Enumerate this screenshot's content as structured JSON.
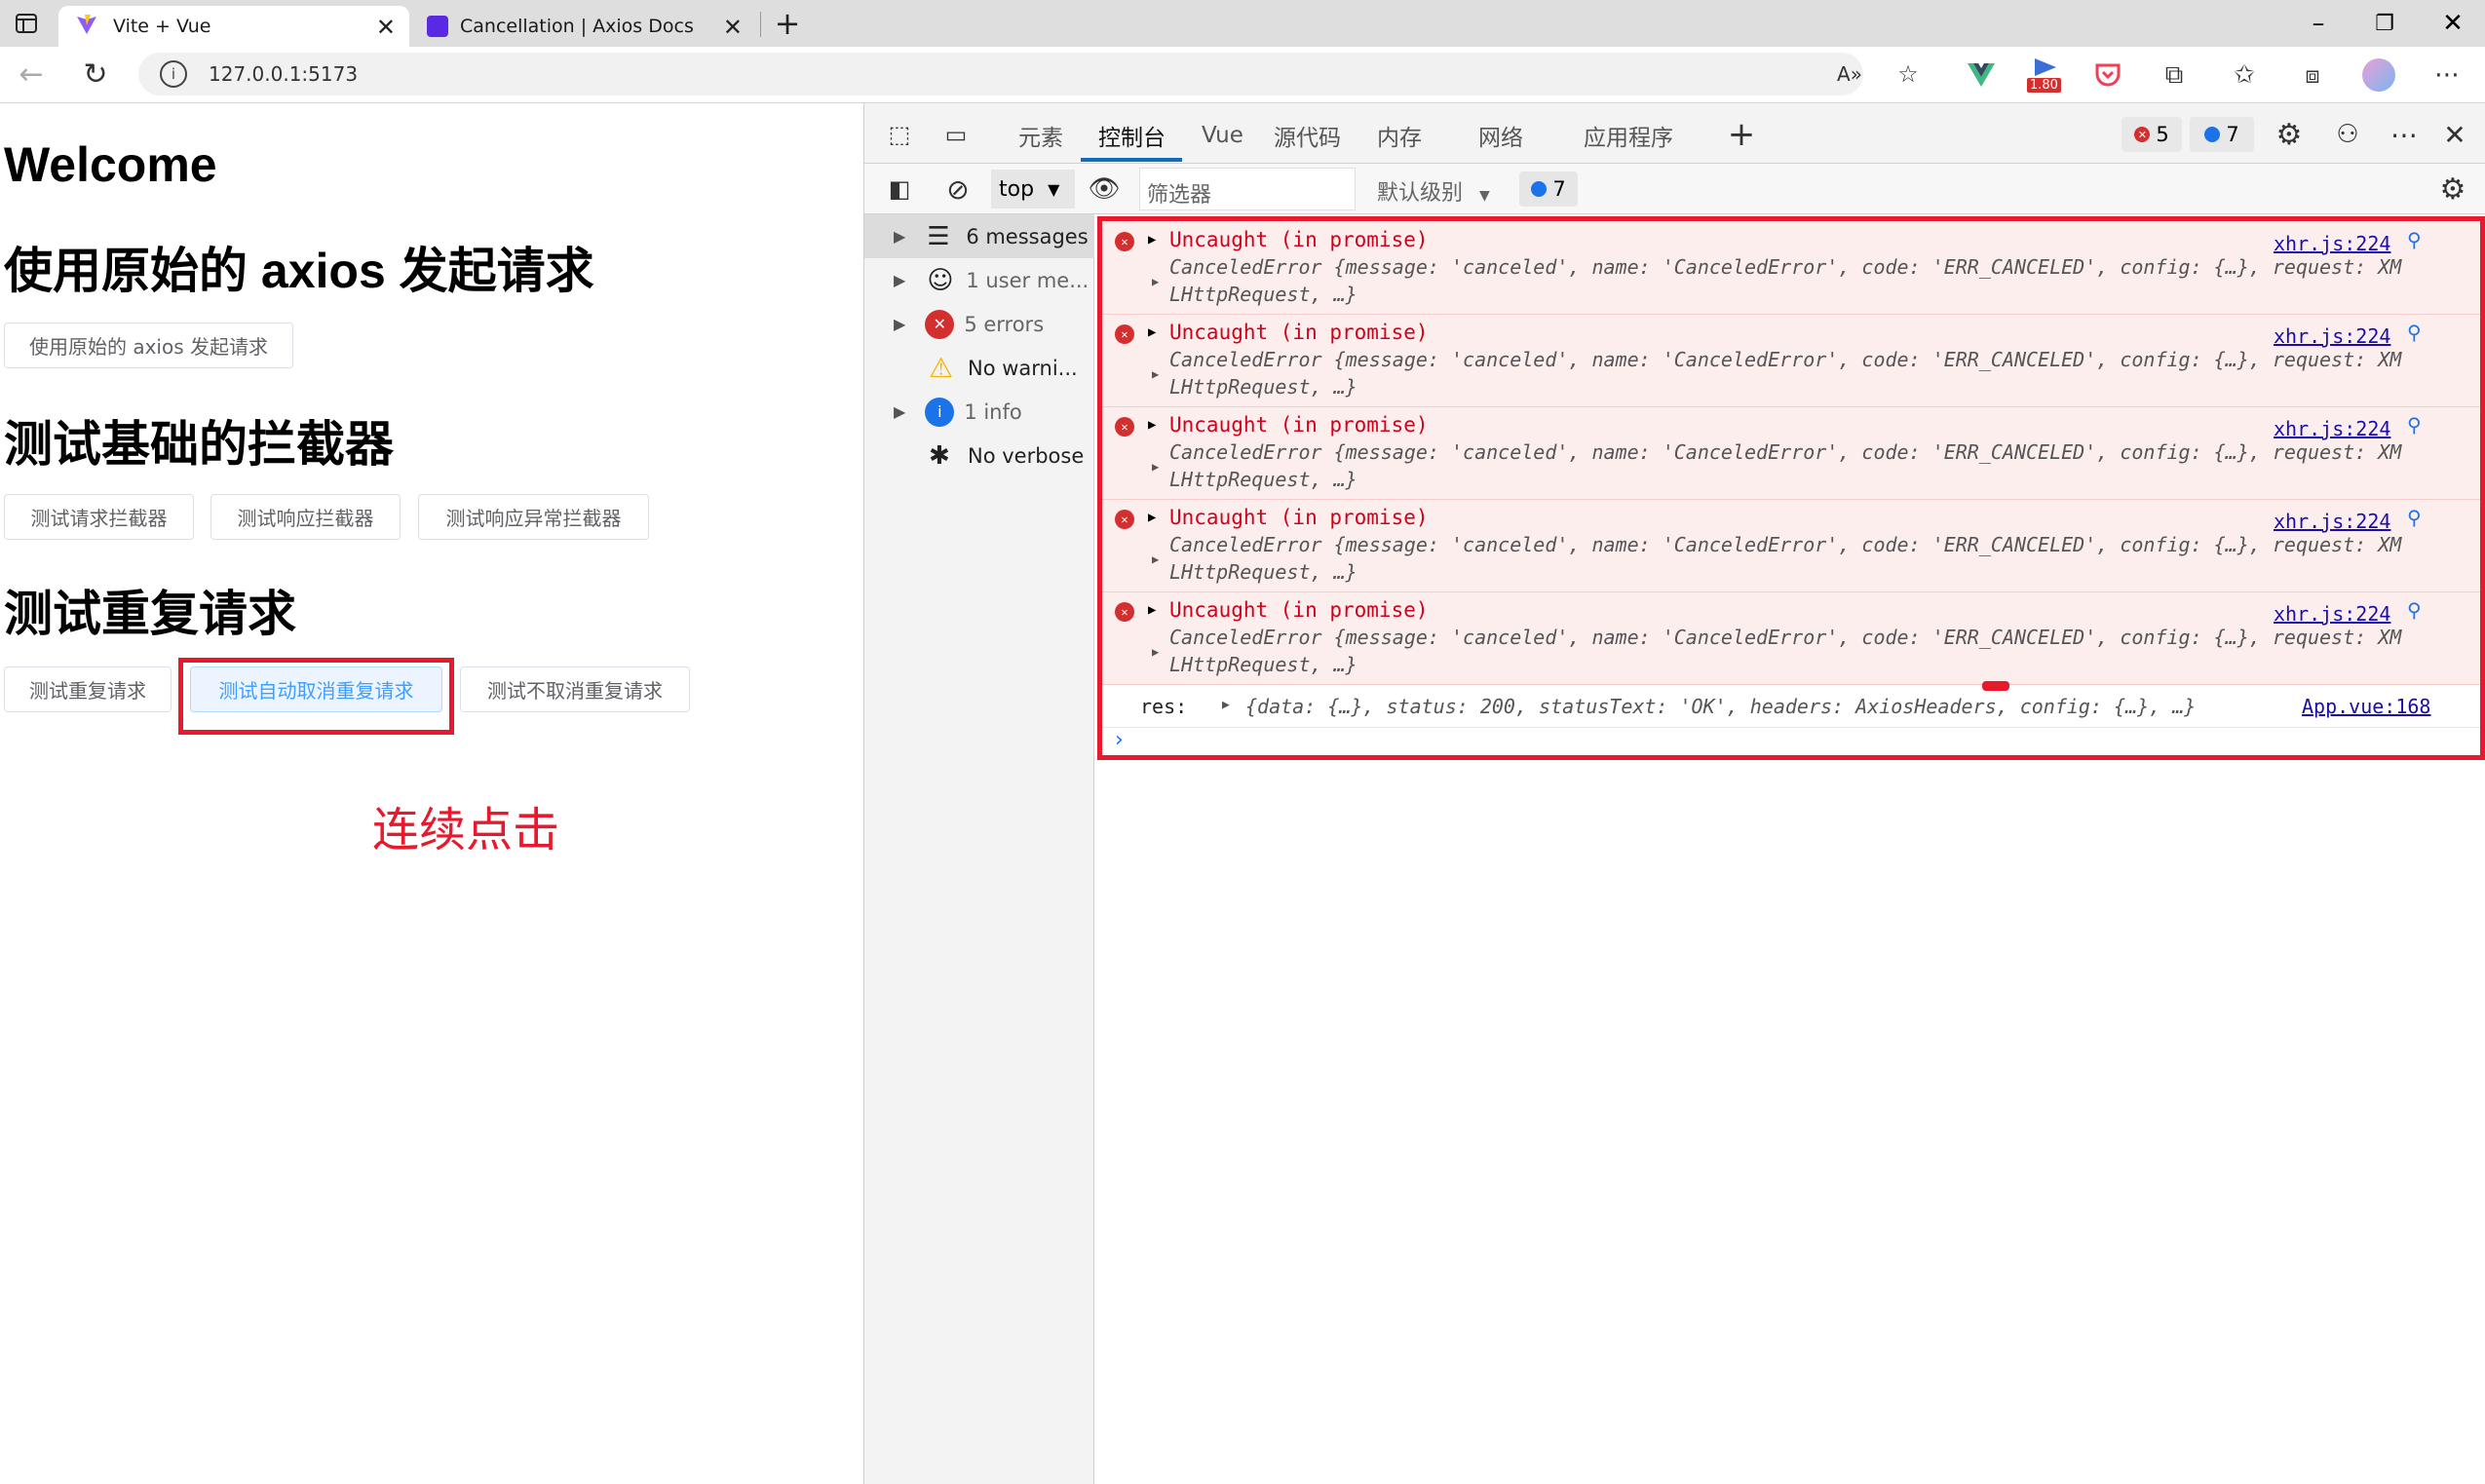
{
  "browser": {
    "tabs": [
      {
        "title": "Vite + Vue",
        "active": true
      },
      {
        "title": "Cancellation | Axios Docs",
        "active": false
      }
    ],
    "url": "127.0.0.1:5173",
    "extension_badge": "1.80"
  },
  "page": {
    "welcome": "Welcome",
    "section1_title": "使用原始的 axios 发起请求",
    "section1_button": "使用原始的 axios 发起请求",
    "section2_title": "测试基础的拦截器",
    "section2_buttons": [
      "测试请求拦截器",
      "测试响应拦截器",
      "测试响应异常拦截器"
    ],
    "section3_title": "测试重复请求",
    "section3_buttons": [
      "测试重复请求",
      "测试自动取消重复请求",
      "测试不取消重复请求"
    ],
    "annotation": "连续点击",
    "colors": {
      "highlight": "#e8192c",
      "accent": "#409eff"
    }
  },
  "devtools": {
    "tabs": [
      "元素",
      "控制台",
      "Vue",
      "源代码",
      "内存",
      "网络",
      "应用程序"
    ],
    "active_tab": "控制台",
    "error_count": "5",
    "info_count": "7",
    "context": "top",
    "filter_placeholder": "筛选器",
    "level": "默认级别",
    "issues_count": "7",
    "sidebar": [
      {
        "label": "6 messages",
        "icon": "list-icon"
      },
      {
        "label": "1 user me...",
        "icon": "user-icon"
      },
      {
        "label": "5 errors",
        "icon": "error-icon"
      },
      {
        "label": "No warni...",
        "icon": "warning-icon"
      },
      {
        "label": "1 info",
        "icon": "info-icon"
      },
      {
        "label": "No verbose",
        "icon": "bug-icon"
      }
    ],
    "messages": [
      {
        "title": "Uncaught (in promise)",
        "detail": "CanceledError {message: 'canceled', name: 'CanceledError', code: 'ERR_CANCELED', config: {…}, request: XM",
        "detail2": "LHttpRequest, …}",
        "source": "xhr.js:224"
      },
      {
        "title": "Uncaught (in promise)",
        "detail": "CanceledError {message: 'canceled', name: 'CanceledError', code: 'ERR_CANCELED', config: {…}, request: XM",
        "detail2": "LHttpRequest, …}",
        "source": "xhr.js:224"
      },
      {
        "title": "Uncaught (in promise)",
        "detail": "CanceledError {message: 'canceled', name: 'CanceledError', code: 'ERR_CANCELED', config: {…}, request: XM",
        "detail2": "LHttpRequest, …}",
        "source": "xhr.js:224"
      },
      {
        "title": "Uncaught (in promise)",
        "detail": "CanceledError {message: 'canceled', name: 'CanceledError', code: 'ERR_CANCELED', config: {…}, request: XM",
        "detail2": "LHttpRequest, …}",
        "source": "xhr.js:224"
      },
      {
        "title": "Uncaught (in promise)",
        "detail": "CanceledError {message: 'canceled', name: 'CanceledError', code: 'ERR_CANCELED', config: {…}, request: XM",
        "detail2": "LHttpRequest, …}",
        "source": "xhr.js:224"
      }
    ],
    "log": {
      "label": "res:",
      "value": "{data: {…}, status: 200, statusText: 'OK', headers: AxiosHeaders, config: {…}, …}",
      "source": "App.vue:168"
    }
  }
}
